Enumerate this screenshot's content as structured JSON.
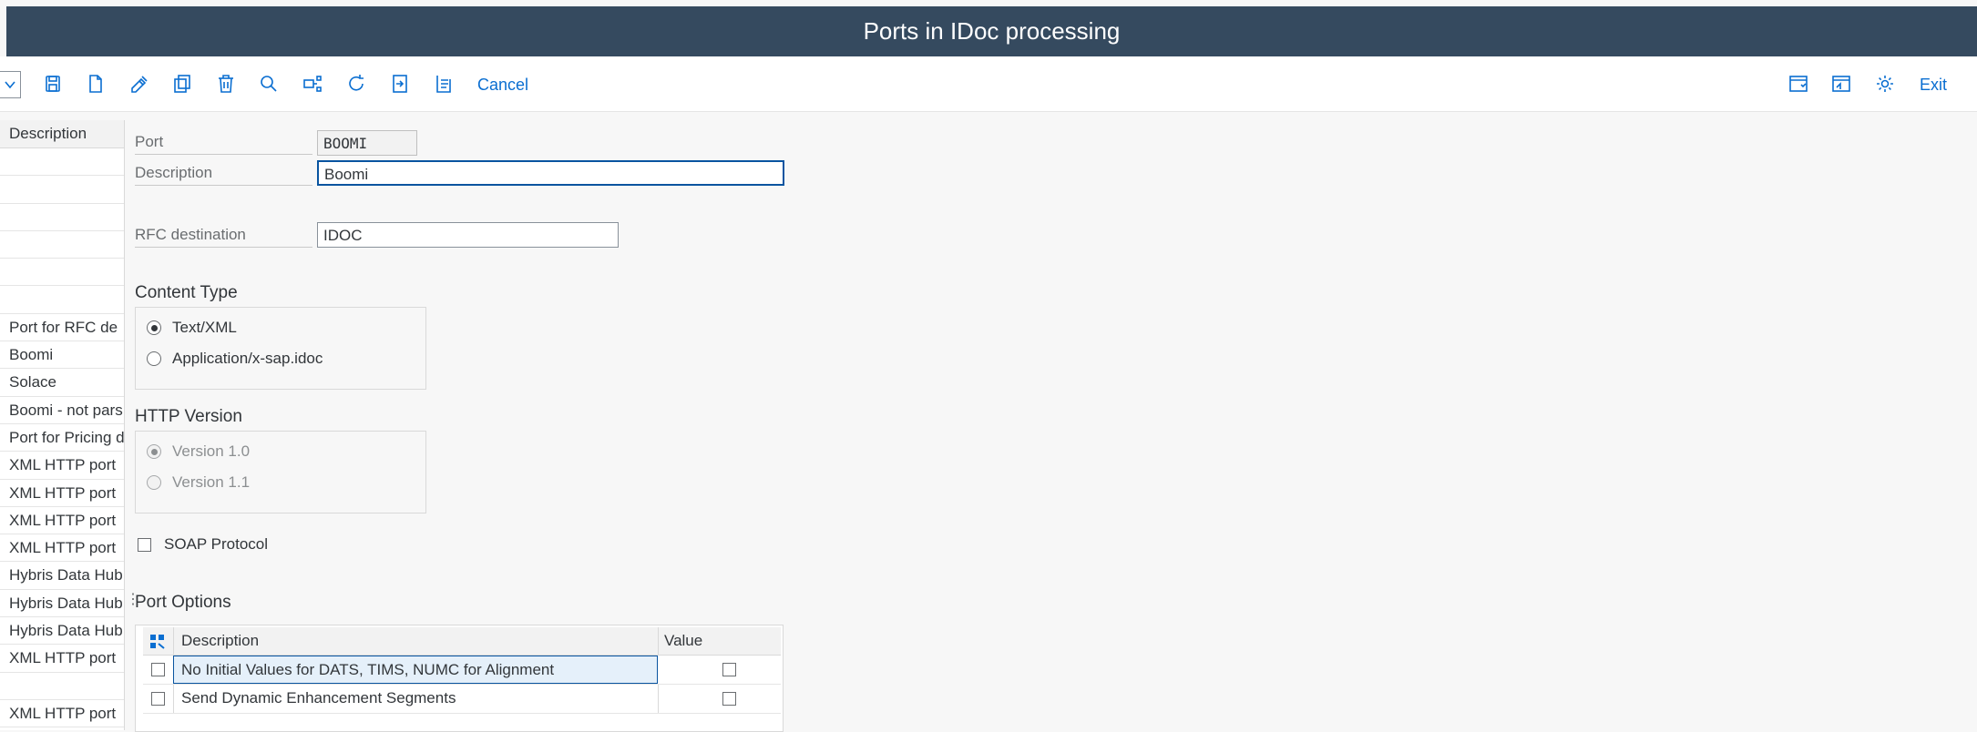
{
  "window": {
    "title": "Ports in IDoc processing"
  },
  "toolbar": {
    "icons": [
      "save-icon",
      "new-icon",
      "edit-icon",
      "copy-icon",
      "delete-icon",
      "find-icon",
      "where-used-icon",
      "refresh-icon",
      "import-icon",
      "export-icon"
    ],
    "cancel_label": "Cancel",
    "exit_label": "Exit",
    "right_icons": [
      "new-session-icon",
      "display-icon",
      "settings-icon"
    ]
  },
  "left_list": {
    "header": "Description",
    "rows": [
      "",
      "",
      "",
      "",
      "",
      "",
      "Port for RFC de",
      " Boomi",
      " Solace",
      "Boomi - not pars",
      "Port for Pricing d",
      "XML HTTP port",
      "XML HTTP port",
      "XML HTTP port",
      "XML HTTP port",
      "Hybris Data Hub",
      "Hybris Data Hub",
      "Hybris Data Hub",
      "XML HTTP port",
      "",
      "XML HTTP port"
    ]
  },
  "form": {
    "port_label": "Port",
    "port_value": "BOOMI",
    "description_label": "Description",
    "description_value": "Boomi",
    "rfc_label": "RFC destination",
    "rfc_value": "IDOC"
  },
  "content_type": {
    "title": "Content Type",
    "options": [
      "Text/XML",
      "Application/x-sap.idoc"
    ],
    "selected": 0
  },
  "http_version": {
    "title": "HTTP Version",
    "options": [
      "Version 1.0",
      "Version 1.1"
    ],
    "selected": 0
  },
  "soap": {
    "label": "SOAP Protocol",
    "checked": false
  },
  "port_options": {
    "title": "Port Options",
    "columns": [
      "Description",
      "Value"
    ],
    "rows": [
      {
        "description": "No Initial Values for DATS, TIMS, NUMC for Alignment",
        "value": false
      },
      {
        "description": "Send Dynamic Enhancement Segments",
        "value": false
      }
    ]
  },
  "colors": {
    "title_bar": "#354a5f",
    "accent": "#0a6ed1"
  }
}
